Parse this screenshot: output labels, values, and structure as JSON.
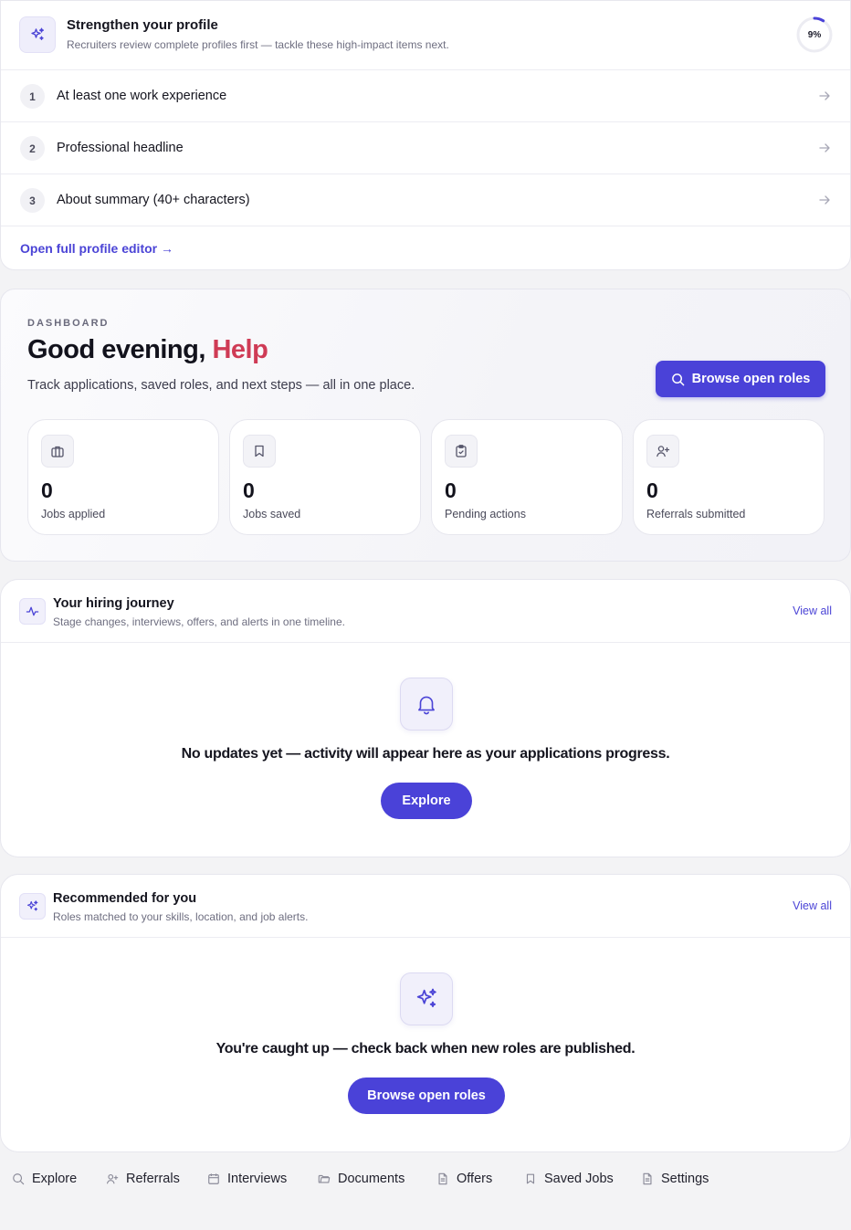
{
  "profile": {
    "title": "Strengthen your profile",
    "subtitle": "Recruiters review complete profiles first — tackle these high-impact items next.",
    "progress_text": "9%",
    "progress_value": 0.09,
    "tasks": [
      {
        "num": "1",
        "label": "At least one work experience"
      },
      {
        "num": "2",
        "label": "Professional headline"
      },
      {
        "num": "3",
        "label": "About summary (40+ characters)"
      }
    ],
    "editor_link": "Open full profile editor →"
  },
  "dashboard": {
    "eyebrow": "DASHBOARD",
    "greeting": "Good evening,",
    "name": "Help",
    "subtitle": "Track applications, saved roles, and next steps — all in one place.",
    "browse_button": "Browse open roles",
    "stats": [
      {
        "value": "0",
        "label": "Jobs applied",
        "icon": "briefcase-icon"
      },
      {
        "value": "0",
        "label": "Jobs saved",
        "icon": "bookmark-icon"
      },
      {
        "value": "0",
        "label": "Pending actions",
        "icon": "clipboard-check-icon"
      },
      {
        "value": "0",
        "label": "Referrals submitted",
        "icon": "user-plus-icon"
      }
    ]
  },
  "journey": {
    "title": "Your hiring journey",
    "subtitle": "Stage changes, interviews, offers, and alerts in one timeline.",
    "view_all": "View all",
    "empty_text": "No updates yet — activity will appear here as your applications progress.",
    "button": "Explore"
  },
  "recommended": {
    "title": "Recommended for you",
    "subtitle": "Roles matched to your skills, location, and job alerts.",
    "view_all": "View all",
    "empty_text": "You're caught up — check back when new roles are published.",
    "button": "Browse open roles"
  },
  "footer_nav": [
    {
      "label": "Explore",
      "icon": "search-icon"
    },
    {
      "label": "Referrals",
      "icon": "user-plus-icon"
    },
    {
      "label": "Interviews",
      "icon": "calendar-icon"
    },
    {
      "label": "Documents",
      "icon": "folder-icon"
    },
    {
      "label": "Offers",
      "icon": "file-icon"
    },
    {
      "label": "Saved Jobs",
      "icon": "bookmark-icon"
    },
    {
      "label": "Settings",
      "icon": "file-icon"
    }
  ],
  "colors": {
    "accent": "#4a42d8",
    "name_highlight": "#cf3b55",
    "background": "#f3f3f5"
  }
}
